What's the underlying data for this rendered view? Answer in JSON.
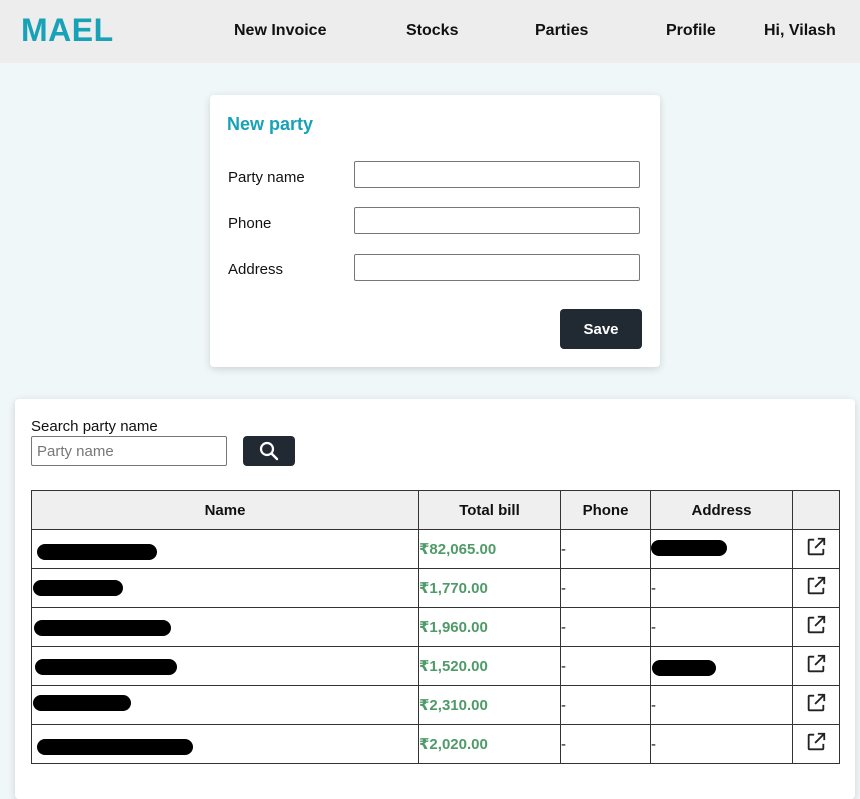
{
  "navbar": {
    "brand": "MAEL",
    "links": [
      "New Invoice",
      "Stocks",
      "Parties",
      "Profile"
    ],
    "greeting": "Hi, Vilash"
  },
  "new_party_form": {
    "title": "New party",
    "fields": [
      {
        "label": "Party name",
        "value": ""
      },
      {
        "label": "Phone",
        "value": ""
      },
      {
        "label": "Address",
        "value": ""
      }
    ],
    "save_label": "Save"
  },
  "search": {
    "label": "Search party name",
    "placeholder": "Party name",
    "value": "",
    "button_icon": "search-icon"
  },
  "table": {
    "headers": [
      "Name",
      "Total bill",
      "Phone",
      "Address",
      ""
    ],
    "rows": [
      {
        "name": "[redacted]",
        "total_bill": "₹82,065.00",
        "phone": "-",
        "address": "[redacted]"
      },
      {
        "name": "[redacted]",
        "total_bill": "₹1,770.00",
        "phone": "-",
        "address": "-"
      },
      {
        "name": "[redacted]",
        "total_bill": "₹1,960.00",
        "phone": "-",
        "address": "-"
      },
      {
        "name": "[redacted]",
        "total_bill": "₹1,520.00",
        "phone": "-",
        "address": "[redacted]"
      },
      {
        "name": "[redacted]",
        "total_bill": "₹2,310.00",
        "phone": "-",
        "address": "-"
      },
      {
        "name": "[redacted]",
        "total_bill": "₹2,020.00",
        "phone": "-",
        "address": "-"
      }
    ],
    "row_action_icon": "external-link-icon"
  },
  "colors": {
    "brand": "#17a2b8",
    "bill_amount": "#4f9a68",
    "dark_button": "#212933",
    "navbar_bg": "#ededed",
    "page_bg": "#f0f7f9"
  }
}
